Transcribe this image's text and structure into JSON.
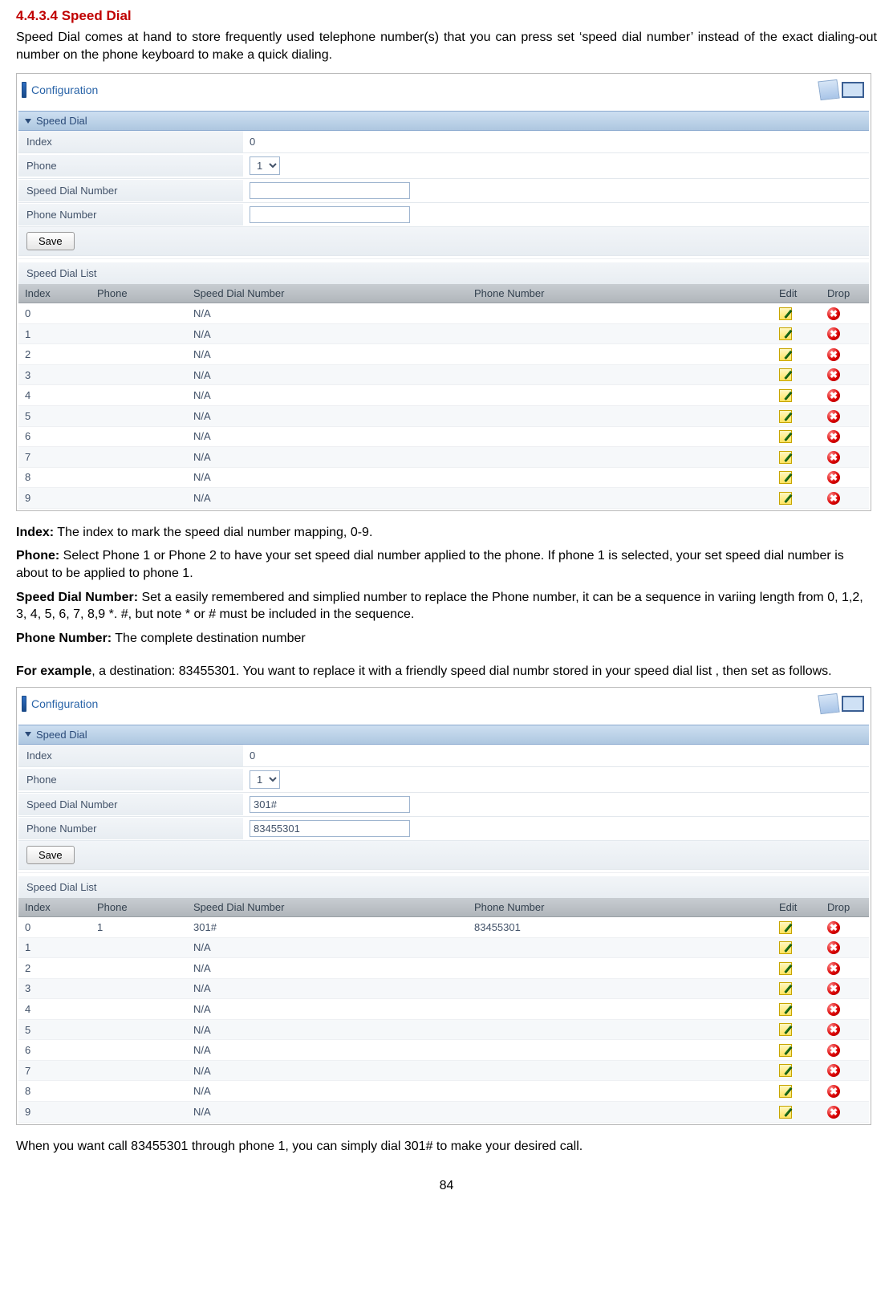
{
  "section_heading": "4.4.3.4 Speed Dial",
  "intro": "Speed Dial comes at hand to store frequently used telephone number(s) that you can press set ‘speed dial number’ instead of the exact dialing-out number on the phone keyboard to make a quick dialing.",
  "config_header_label": "Configuration",
  "section_strip_label": "Speed Dial",
  "form": {
    "index_label": "Index",
    "index_value": "0",
    "phone_label": "Phone",
    "phone_selected": "1",
    "speed_dial_label": "Speed Dial Number",
    "phone_number_label": "Phone Number",
    "save_button": "Save"
  },
  "list_title": "Speed Dial List",
  "list_columns": {
    "index": "Index",
    "phone": "Phone",
    "sdn": "Speed Dial Number",
    "pn": "Phone Number",
    "edit": "Edit",
    "drop": "Drop"
  },
  "list1_rows": [
    {
      "index": "0",
      "phone": "",
      "sdn": "N/A",
      "pn": ""
    },
    {
      "index": "1",
      "phone": "",
      "sdn": "N/A",
      "pn": ""
    },
    {
      "index": "2",
      "phone": "",
      "sdn": "N/A",
      "pn": ""
    },
    {
      "index": "3",
      "phone": "",
      "sdn": "N/A",
      "pn": ""
    },
    {
      "index": "4",
      "phone": "",
      "sdn": "N/A",
      "pn": ""
    },
    {
      "index": "5",
      "phone": "",
      "sdn": "N/A",
      "pn": ""
    },
    {
      "index": "6",
      "phone": "",
      "sdn": "N/A",
      "pn": ""
    },
    {
      "index": "7",
      "phone": "",
      "sdn": "N/A",
      "pn": ""
    },
    {
      "index": "8",
      "phone": "",
      "sdn": "N/A",
      "pn": ""
    },
    {
      "index": "9",
      "phone": "",
      "sdn": "N/A",
      "pn": ""
    }
  ],
  "defs": {
    "index_label": "Index:",
    "index_text": " The index to mark the speed dial number mapping, 0-9.",
    "phone_label": "Phone:",
    "phone_text": " Select Phone 1 or Phone 2 to have your set speed dial number applied to the phone. If phone 1 is selected, your set speed dial number is about to be applied to phone 1.",
    "sdn_label": "Speed Dial Number:",
    "sdn_text": " Set a easily remembered and simplied number to replace the Phone number, it can be a sequence  in variing length from 0, 1,2, 3, 4, 5, 6, 7, 8,9 *. #, but note * or # must be included in the sequence.",
    "pn_label": "Phone Number:",
    "pn_text": " The complete destination number"
  },
  "example_intro_label": "For example",
  "example_intro_text": ", a destination: 83455301. You want to replace it with a friendly speed dial numbr stored in your speed dial list , then set as follows.",
  "form2": {
    "speed_dial_value": "301#",
    "phone_number_value": "83455301"
  },
  "list2_rows": [
    {
      "index": "0",
      "phone": "1",
      "sdn": "301#",
      "pn": "83455301"
    },
    {
      "index": "1",
      "phone": "",
      "sdn": "N/A",
      "pn": ""
    },
    {
      "index": "2",
      "phone": "",
      "sdn": "N/A",
      "pn": ""
    },
    {
      "index": "3",
      "phone": "",
      "sdn": "N/A",
      "pn": ""
    },
    {
      "index": "4",
      "phone": "",
      "sdn": "N/A",
      "pn": ""
    },
    {
      "index": "5",
      "phone": "",
      "sdn": "N/A",
      "pn": ""
    },
    {
      "index": "6",
      "phone": "",
      "sdn": "N/A",
      "pn": ""
    },
    {
      "index": "7",
      "phone": "",
      "sdn": "N/A",
      "pn": ""
    },
    {
      "index": "8",
      "phone": "",
      "sdn": "N/A",
      "pn": ""
    },
    {
      "index": "9",
      "phone": "",
      "sdn": "N/A",
      "pn": ""
    }
  ],
  "conclusion": "When you want call 83455301 through phone 1, you can simply dial 301# to make your desired call.",
  "page_number": "84"
}
